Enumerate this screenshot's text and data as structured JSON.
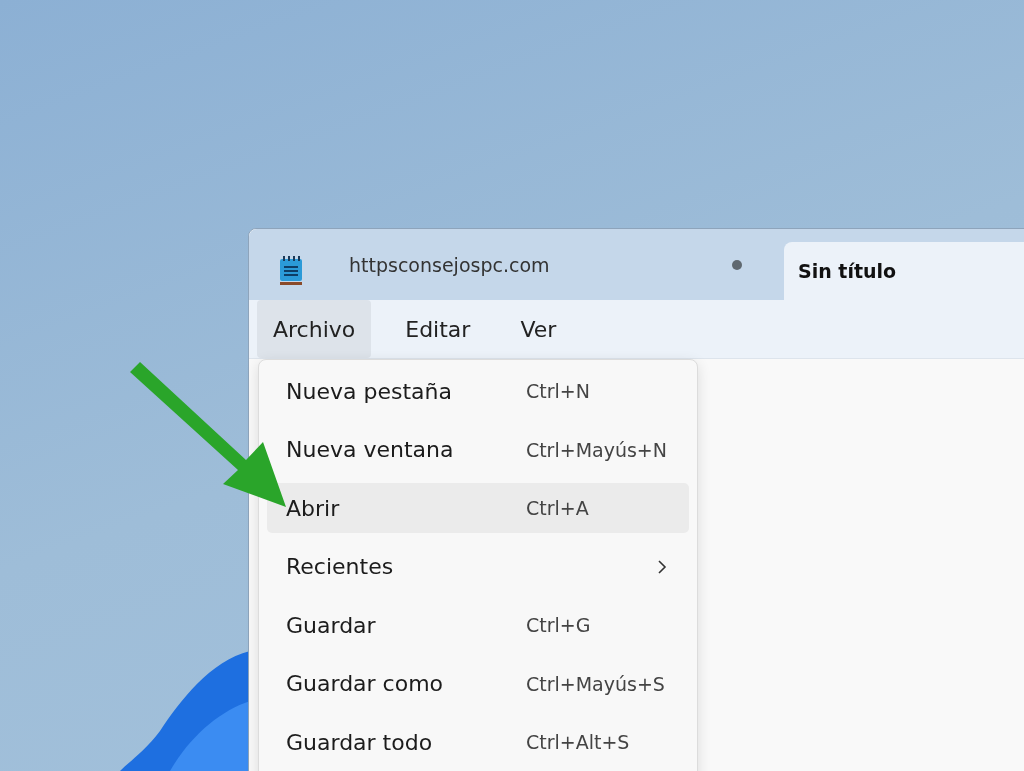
{
  "tabs": [
    {
      "label": "httpsconsejospc.com",
      "selected": false,
      "modified": true
    },
    {
      "label": "Sin título",
      "selected": true,
      "modified": false
    }
  ],
  "menu_bar": [
    {
      "label": "Archivo",
      "selected": true
    },
    {
      "label": "Editar",
      "selected": false
    },
    {
      "label": "Ver",
      "selected": false
    }
  ],
  "file_menu": [
    {
      "label": "Nueva pestaña",
      "shortcut": "Ctrl+N",
      "kind": "command",
      "selected": false
    },
    {
      "label": "Nueva ventana",
      "shortcut": "Ctrl+Mayús+N",
      "kind": "command",
      "selected": false
    },
    {
      "label": "Abrir",
      "shortcut": "Ctrl+A",
      "kind": "command",
      "selected": true
    },
    {
      "label": "Recientes",
      "kind": "submenu",
      "selected": false
    },
    {
      "label": "Guardar",
      "shortcut": "Ctrl+G",
      "kind": "command",
      "selected": false
    },
    {
      "label": "Guardar como",
      "shortcut": "Ctrl+Mayús+S",
      "kind": "command",
      "selected": false
    },
    {
      "label": "Guardar todo",
      "shortcut": "Ctrl+Alt+S",
      "kind": "command",
      "selected": false
    }
  ]
}
